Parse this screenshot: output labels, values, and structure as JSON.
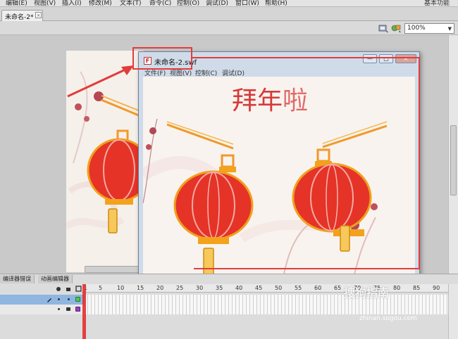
{
  "menubar": {
    "items": [
      "编辑(E)",
      "视图(V)",
      "插入(I)",
      "修改(M)",
      "文本(T)",
      "命令(C)",
      "控制(O)",
      "调试(D)",
      "窗口(W)",
      "帮助(H)"
    ],
    "workspace": "基本功能"
  },
  "tabs": {
    "doc_title": "未命名-2*",
    "close": "×"
  },
  "editbar": {
    "zoom": "100%",
    "zoom_arrow": "▼"
  },
  "swf_window": {
    "title": "未命名-2.swf",
    "icon_glyph": "F",
    "menu": [
      "文件(F)",
      "视图(V)",
      "控制(C)",
      "调试(D)"
    ],
    "buttons": {
      "minimize": "—",
      "maximize": "□",
      "close": "✕"
    }
  },
  "content": {
    "greeting_prefix": "拜年",
    "greeting_suffix": "啦"
  },
  "timeline": {
    "tabs": [
      "编译器错误",
      "动画编辑器"
    ],
    "frame_numbers": [
      "1",
      "5",
      "10",
      "15",
      "20",
      "25",
      "30",
      "35",
      "40",
      "45",
      "50",
      "55",
      "60",
      "65",
      "70",
      "75",
      "80",
      "85",
      "90"
    ]
  },
  "watermark": {
    "main": "搜狗指南",
    "sub": "zhinan.sogou.com"
  },
  "colors": {
    "lantern_red": "#e53328",
    "lantern_gold": "#f3a21c",
    "highlight_red": "#e23c3c"
  }
}
